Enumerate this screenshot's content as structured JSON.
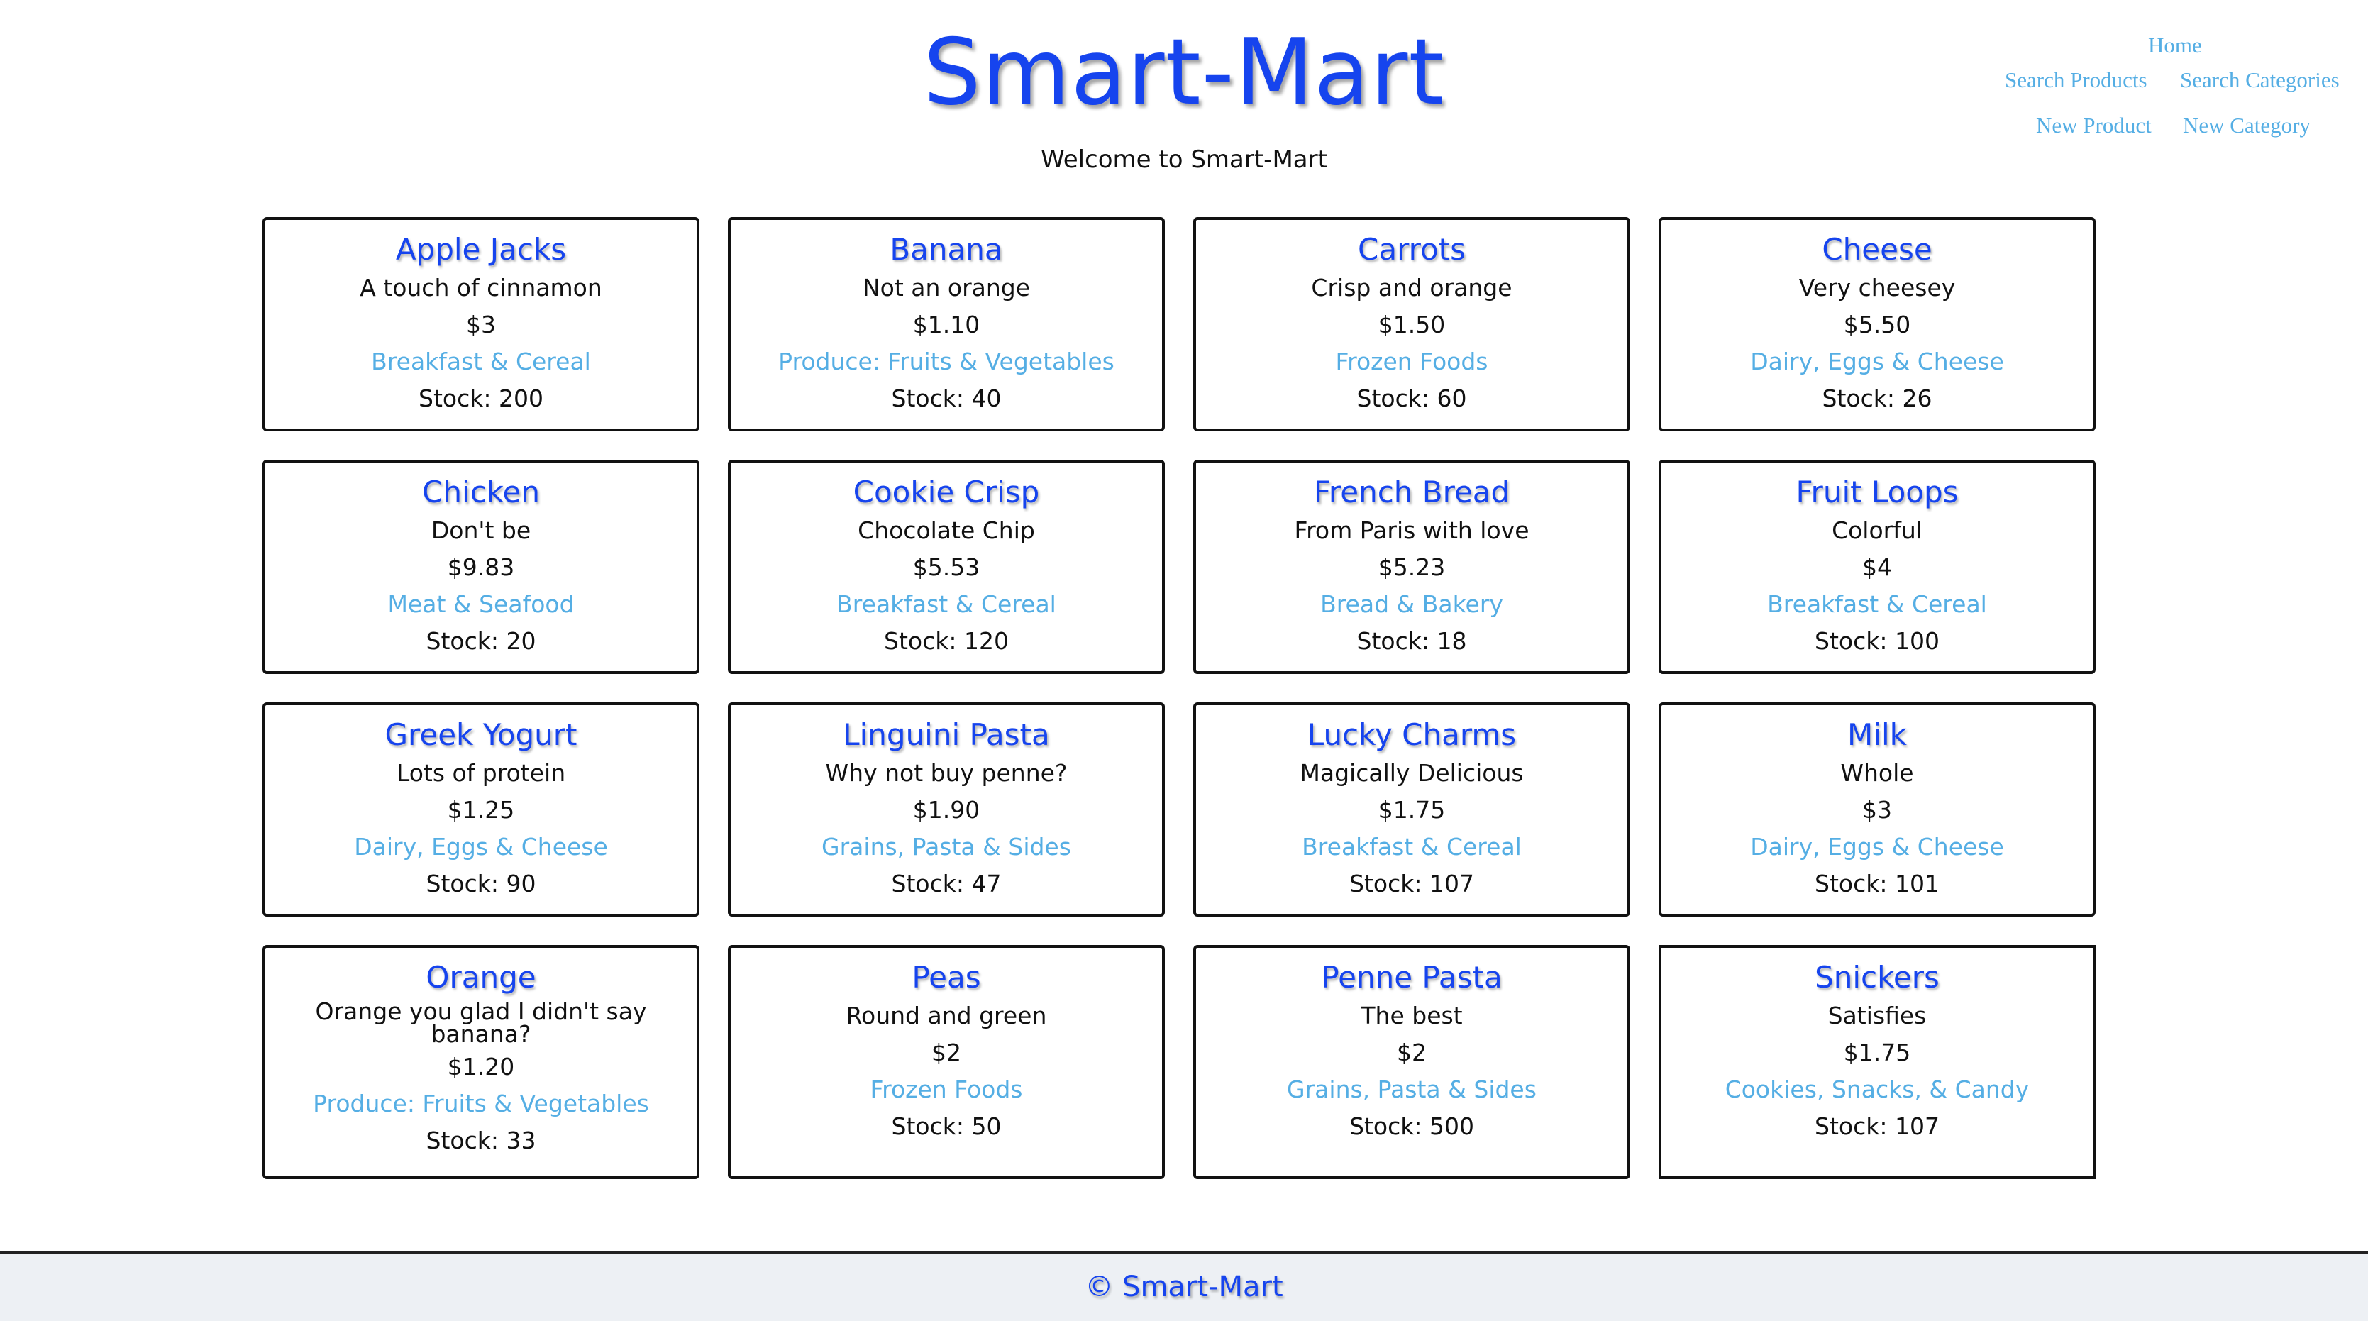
{
  "header": {
    "brand": "Smart-Mart",
    "welcome": "Welcome to Smart-Mart"
  },
  "nav": {
    "home": "Home",
    "search_products": "Search Products",
    "search_categories": "Search Categories",
    "new_product": "New Product",
    "new_category": "New Category"
  },
  "products": [
    {
      "name": "Apple Jacks",
      "description": "A touch of cinnamon",
      "price": "$3",
      "category": "Breakfast & Cereal",
      "stock": "Stock: 200"
    },
    {
      "name": "Banana",
      "description": "Not an orange",
      "price": "$1.10",
      "category": "Produce: Fruits & Vegetables",
      "stock": "Stock: 40"
    },
    {
      "name": "Carrots",
      "description": "Crisp and orange",
      "price": "$1.50",
      "category": "Frozen Foods",
      "stock": "Stock: 60"
    },
    {
      "name": "Cheese",
      "description": "Very cheesey",
      "price": "$5.50",
      "category": "Dairy, Eggs & Cheese",
      "stock": "Stock: 26"
    },
    {
      "name": "Chicken",
      "description": "Don't be",
      "price": "$9.83",
      "category": "Meat & Seafood",
      "stock": "Stock: 20"
    },
    {
      "name": "Cookie Crisp",
      "description": "Chocolate Chip",
      "price": "$5.53",
      "category": "Breakfast & Cereal",
      "stock": "Stock: 120"
    },
    {
      "name": "French Bread",
      "description": "From Paris with love",
      "price": "$5.23",
      "category": "Bread & Bakery",
      "stock": "Stock: 18"
    },
    {
      "name": "Fruit Loops",
      "description": "Colorful",
      "price": "$4",
      "category": "Breakfast & Cereal",
      "stock": "Stock: 100"
    },
    {
      "name": "Greek Yogurt",
      "description": "Lots of protein",
      "price": "$1.25",
      "category": "Dairy, Eggs & Cheese",
      "stock": "Stock: 90"
    },
    {
      "name": "Linguini Pasta",
      "description": "Why not buy penne?",
      "price": "$1.90",
      "category": "Grains, Pasta & Sides",
      "stock": "Stock: 47"
    },
    {
      "name": "Lucky Charms",
      "description": "Magically Delicious",
      "price": "$1.75",
      "category": "Breakfast & Cereal",
      "stock": "Stock: 107"
    },
    {
      "name": "Milk",
      "description": "Whole",
      "price": "$3",
      "category": "Dairy, Eggs & Cheese",
      "stock": "Stock: 101"
    },
    {
      "name": "Orange",
      "description": "Orange you glad I didn't say banana?",
      "price": "$1.20",
      "category": "Produce: Fruits & Vegetables",
      "stock": "Stock: 33"
    },
    {
      "name": "Peas",
      "description": "Round and green",
      "price": "$2",
      "category": "Frozen Foods",
      "stock": "Stock: 50"
    },
    {
      "name": "Penne Pasta",
      "description": "The best",
      "price": "$2",
      "category": "Grains, Pasta & Sides",
      "stock": "Stock: 500"
    },
    {
      "name": "Snickers",
      "description": "Satisfies",
      "price": "$1.75",
      "category": "Cookies, Snacks, & Candy",
      "stock": "Stock: 107"
    }
  ],
  "footer": {
    "text": "© Smart-Mart"
  },
  "colors": {
    "brand": "#1644ee",
    "link": "#55aee4",
    "footer_bg": "#edf0f4"
  }
}
